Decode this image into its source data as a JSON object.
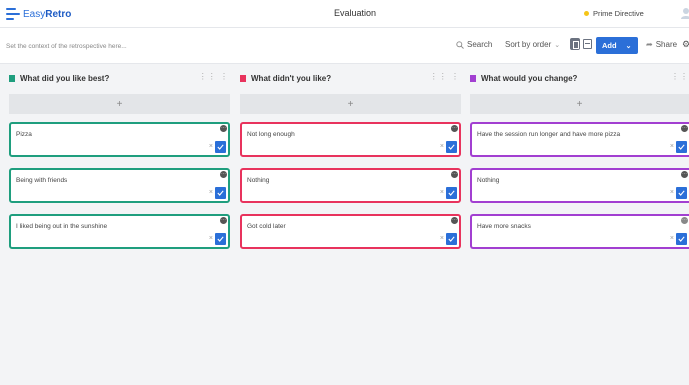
{
  "app": {
    "logo_light": "Easy",
    "logo_bold": "Retro",
    "brand_color": "#2b6fd8"
  },
  "header": {
    "board_title": "Evaluation",
    "prime_directive": "Prime Directive"
  },
  "toolbar": {
    "context_placeholder": "Set the context of the retrospective here...",
    "search_label": "Search",
    "sort_label": "Sort by order",
    "add_label": "Add",
    "share_label": "Share"
  },
  "columns": [
    {
      "title": "What did you like best?",
      "color": "#1f9e7e",
      "cards": [
        {
          "text": "Pizza"
        },
        {
          "text": "Being with friends"
        },
        {
          "text": "I liked being out in the sunshine"
        }
      ]
    },
    {
      "title": "What didn't you like?",
      "color": "#e8335d",
      "cards": [
        {
          "text": "Not long enough"
        },
        {
          "text": "Nothing"
        },
        {
          "text": "Got cold later"
        }
      ]
    },
    {
      "title": "What would you change?",
      "color": "#a23fd1",
      "cards": [
        {
          "text": "Have the session run longer and have more pizza"
        },
        {
          "text": "Nothing"
        },
        {
          "text": "Have more snacks"
        }
      ]
    }
  ]
}
